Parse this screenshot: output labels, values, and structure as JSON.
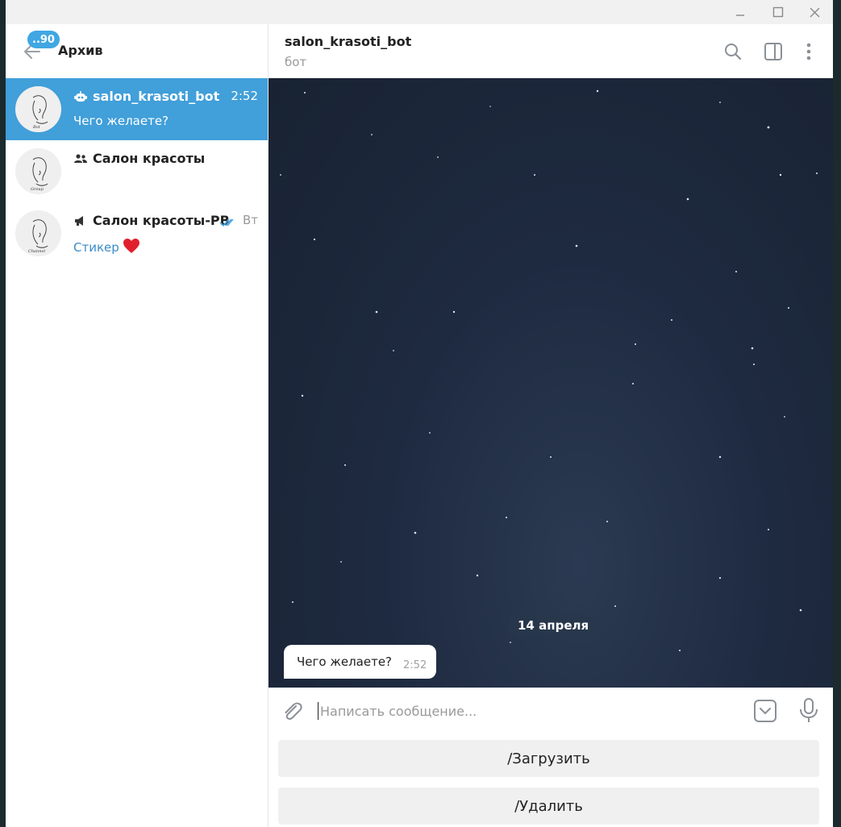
{
  "sidebar": {
    "badge": "..90",
    "title": "Архив",
    "chats": [
      {
        "name": "salon_krasoti_bot",
        "time": "2:52",
        "preview": "Чего желаете?",
        "type_icon": "bot-icon",
        "active": true
      },
      {
        "name": "Салон красоты",
        "time": "",
        "preview": "",
        "type_icon": "group-icon",
        "active": false
      },
      {
        "name": "Салон красоты-РВ",
        "time": "Вт",
        "preview": "Стикер",
        "preview_emoji": "❤️",
        "type_icon": "channel-icon",
        "status_icon": "double-check-icon",
        "active": false
      }
    ]
  },
  "chat": {
    "title": "salon_krasoti_bot",
    "subtitle": "бот",
    "date_separator": "14 апреля",
    "messages": [
      {
        "text": "Чего желаете?",
        "time": "2:52"
      }
    ],
    "input_placeholder": "Написать сообщение...",
    "keyboard_buttons": [
      "/Загрузить",
      "/Удалить"
    ]
  },
  "colors": {
    "accent": "#419fd9",
    "badge": "#40a7e3",
    "background_night": "#1e2a40"
  },
  "icons": [
    "minimize-icon",
    "maximize-icon",
    "close-icon",
    "back-arrow-icon",
    "search-icon",
    "sidebar-toggle-icon",
    "more-vertical-icon",
    "paperclip-icon",
    "bot-keyboard-icon",
    "microphone-icon"
  ]
}
